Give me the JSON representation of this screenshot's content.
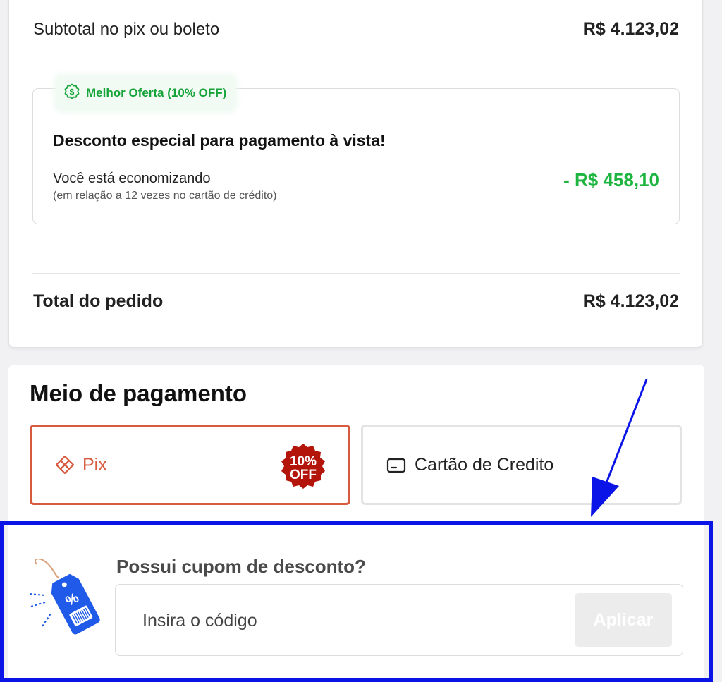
{
  "summary": {
    "subtotal_label": "Subtotal no pix ou boleto",
    "subtotal_value": "R$ 4.123,02",
    "offer": {
      "badge": "Melhor Oferta (10% OFF)",
      "title": "Desconto especial para pagamento à vista!",
      "saving_label": "Você está economizando",
      "saving_note": "(em relação a 12 vezes no cartão de crédito)",
      "saving_value": "- R$ 458,10"
    },
    "total_label": "Total do pedido",
    "total_value": "R$ 4.123,02"
  },
  "payment": {
    "title": "Meio de pagamento",
    "options": [
      {
        "label": "Pix",
        "icon": "pix-icon",
        "badge_line1": "10%",
        "badge_line2": "OFF",
        "selected": true
      },
      {
        "label": "Cartão de Credito",
        "icon": "credit-card-icon",
        "selected": false
      }
    ]
  },
  "coupon": {
    "title": "Possui cupom de desconto?",
    "placeholder": "Insira o código",
    "value": "",
    "apply_label": "Aplicar",
    "icon": "discount-tag-icon"
  },
  "colors": {
    "accent": "#d75a3f",
    "saving_green": "#1db540",
    "highlight_blue": "#0a14e6",
    "tag_blue": "#1f5be8"
  }
}
